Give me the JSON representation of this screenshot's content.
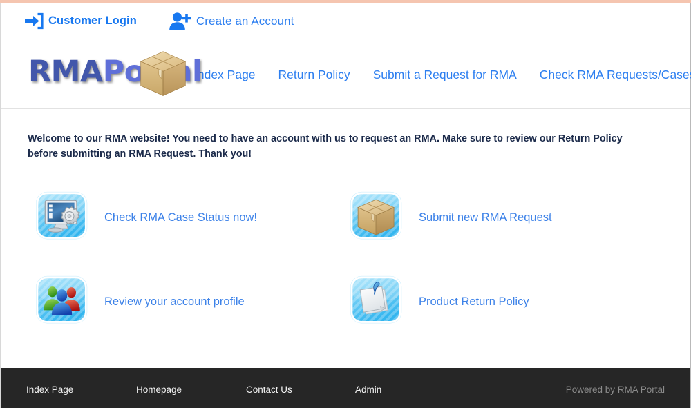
{
  "topbar": {
    "login": {
      "label": "Customer Login",
      "icon": "sign-in-icon"
    },
    "create_account": {
      "label": "Create an Account",
      "icon": "user-plus-icon"
    }
  },
  "header": {
    "logo": {
      "part1": "RMA",
      "part2": "Portal",
      "icon": "cardboard-box-icon"
    },
    "nav": [
      {
        "label": "Index Page"
      },
      {
        "label": "Return Policy"
      },
      {
        "label": "Submit a Request for RMA"
      },
      {
        "label": "Check RMA Requests/Cases Status"
      }
    ]
  },
  "main": {
    "welcome_text": "Welcome to our RMA website! You need to have an account with us to request an RMA. Make sure to review our Return Policy before submitting an RMA Request. Thank you!",
    "tiles": [
      {
        "label": "Check RMA Case Status now!",
        "icon": "monitor-gear-icon"
      },
      {
        "label": "Submit new RMA Request",
        "icon": "cardboard-box-icon"
      },
      {
        "label": "Review your account profile",
        "icon": "users-group-icon"
      },
      {
        "label": "Product Return Policy",
        "icon": "pinned-documents-icon"
      }
    ]
  },
  "footer": {
    "links": [
      {
        "label": "Index Page"
      },
      {
        "label": "Homepage"
      },
      {
        "label": "Contact Us"
      },
      {
        "label": "Admin"
      }
    ],
    "credit": "Powered by RMA Portal"
  },
  "colors": {
    "link_blue": "#3d82e8",
    "nav_blue": "#2d7ff0",
    "logo_rma": "#4257ab",
    "logo_portal": "#5f6fd8",
    "welcome_text": "#1b2a4a",
    "footer_bg": "#262626",
    "footer_credit": "#8b8b8b",
    "top_accent": "#f5c5b0"
  }
}
